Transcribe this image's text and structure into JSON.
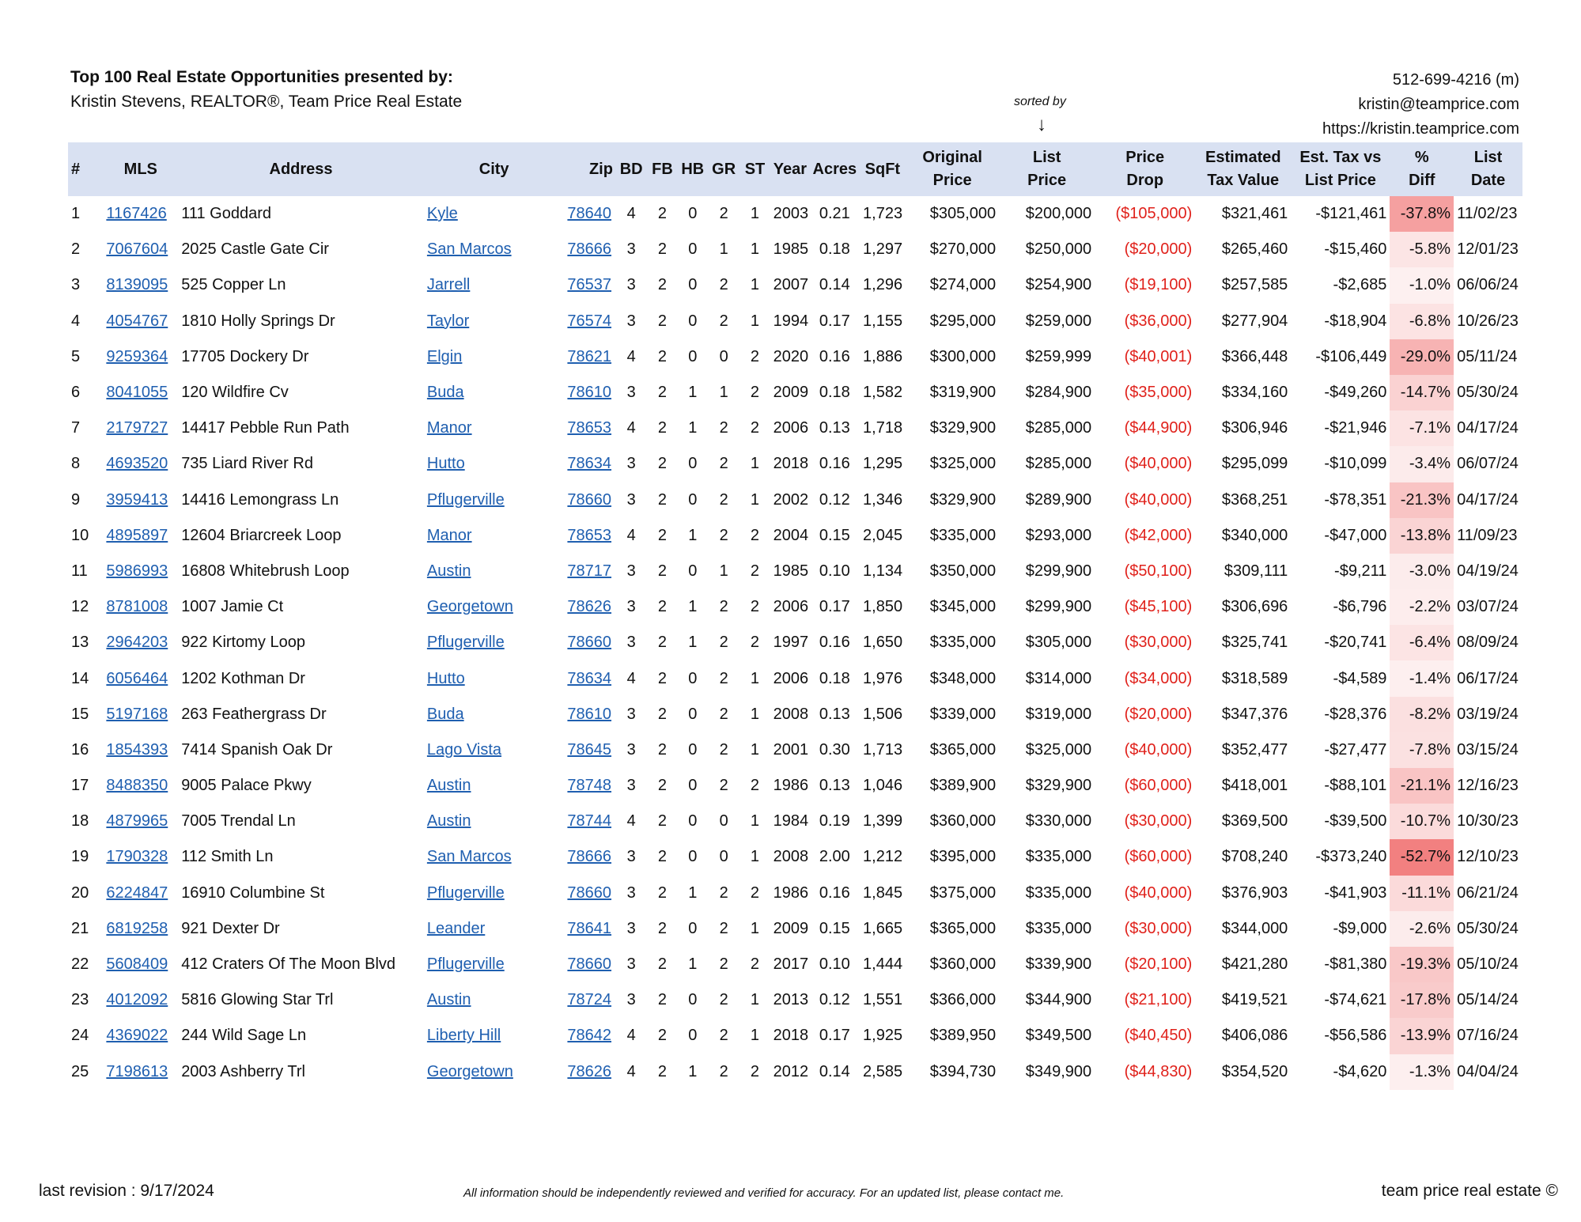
{
  "header": {
    "title": "Top 100 Real Estate Opportunities presented by:",
    "subtitle": "Kristin Stevens, REALTOR®, Team Price Real Estate",
    "sorted_by": "sorted by",
    "sort_arrow": "↓"
  },
  "contact": {
    "phone": "512-699-4216 (m)",
    "email": "kristin@teamprice.com",
    "website": "https://kristin.teamprice.com"
  },
  "columns": {
    "num": "#",
    "mls": "MLS",
    "address": "Address",
    "city": "City",
    "zip": "Zip",
    "bd": "BD",
    "fb": "FB",
    "hb": "HB",
    "gr": "GR",
    "st": "ST",
    "year": "Year",
    "acres": "Acres",
    "sqft": "SqFt",
    "orig_price_1": "Original",
    "orig_price_2": "Price",
    "list_price_1": "List",
    "list_price_2": "Price",
    "price_drop_1": "Price",
    "price_drop_2": "Drop",
    "tax_value_1": "Estimated",
    "tax_value_2": "Tax Value",
    "tax_vs_list_1": "Est. Tax vs",
    "tax_vs_list_2": "List Price",
    "pct_diff_1": "%",
    "pct_diff_2": "Diff",
    "list_date_1": "List",
    "list_date_2": "Date"
  },
  "pct_color_high": "#f28080",
  "pct_color_low": "#fdf2f2",
  "drop_color": "#e0211b",
  "link_color": "#1f5fb0",
  "header_bg": "#d9e1f2",
  "rows": [
    {
      "num": "1",
      "mls": "1167426",
      "address": "111 Goddard",
      "city": "Kyle",
      "zip": "78640",
      "bd": "4",
      "fb": "2",
      "hb": "0",
      "gr": "2",
      "st": "1",
      "year": "2003",
      "acres": "0.21",
      "sqft": "1,723",
      "orig": "$305,000",
      "list": "$200,000",
      "drop": "($105,000)",
      "tax": "$321,461",
      "diff": "-$121,461",
      "pct": "-37.8%",
      "pct_value": -37.8,
      "date": "11/02/23"
    },
    {
      "num": "2",
      "mls": "7067604",
      "address": "2025 Castle Gate Cir",
      "city": "San Marcos",
      "zip": "78666",
      "bd": "3",
      "fb": "2",
      "hb": "0",
      "gr": "1",
      "st": "1",
      "year": "1985",
      "acres": "0.18",
      "sqft": "1,297",
      "orig": "$270,000",
      "list": "$250,000",
      "drop": "($20,000)",
      "tax": "$265,460",
      "diff": "-$15,460",
      "pct": "-5.8%",
      "pct_value": -5.8,
      "date": "12/01/23"
    },
    {
      "num": "3",
      "mls": "8139095",
      "address": "525 Copper Ln",
      "city": "Jarrell",
      "zip": "76537",
      "bd": "3",
      "fb": "2",
      "hb": "0",
      "gr": "2",
      "st": "1",
      "year": "2007",
      "acres": "0.14",
      "sqft": "1,296",
      "orig": "$274,000",
      "list": "$254,900",
      "drop": "($19,100)",
      "tax": "$257,585",
      "diff": "-$2,685",
      "pct": "-1.0%",
      "pct_value": -1.0,
      "date": "06/06/24"
    },
    {
      "num": "4",
      "mls": "4054767",
      "address": "1810 Holly Springs Dr",
      "city": "Taylor",
      "zip": "76574",
      "bd": "3",
      "fb": "2",
      "hb": "0",
      "gr": "2",
      "st": "1",
      "year": "1994",
      "acres": "0.17",
      "sqft": "1,155",
      "orig": "$295,000",
      "list": "$259,000",
      "drop": "($36,000)",
      "tax": "$277,904",
      "diff": "-$18,904",
      "pct": "-6.8%",
      "pct_value": -6.8,
      "date": "10/26/23"
    },
    {
      "num": "5",
      "mls": "9259364",
      "address": "17705 Dockery Dr",
      "city": "Elgin",
      "zip": "78621",
      "bd": "4",
      "fb": "2",
      "hb": "0",
      "gr": "0",
      "st": "2",
      "year": "2020",
      "acres": "0.16",
      "sqft": "1,886",
      "orig": "$300,000",
      "list": "$259,999",
      "drop": "($40,001)",
      "tax": "$366,448",
      "diff": "-$106,449",
      "pct": "-29.0%",
      "pct_value": -29.0,
      "date": "05/11/24"
    },
    {
      "num": "6",
      "mls": "8041055",
      "address": "120 Wildfire Cv",
      "city": "Buda",
      "zip": "78610",
      "bd": "3",
      "fb": "2",
      "hb": "1",
      "gr": "1",
      "st": "2",
      "year": "2009",
      "acres": "0.18",
      "sqft": "1,582",
      "orig": "$319,900",
      "list": "$284,900",
      "drop": "($35,000)",
      "tax": "$334,160",
      "diff": "-$49,260",
      "pct": "-14.7%",
      "pct_value": -14.7,
      "date": "05/30/24"
    },
    {
      "num": "7",
      "mls": "2179727",
      "address": "14417 Pebble Run Path",
      "city": "Manor",
      "zip": "78653",
      "bd": "4",
      "fb": "2",
      "hb": "1",
      "gr": "2",
      "st": "2",
      "year": "2006",
      "acres": "0.13",
      "sqft": "1,718",
      "orig": "$329,900",
      "list": "$285,000",
      "drop": "($44,900)",
      "tax": "$306,946",
      "diff": "-$21,946",
      "pct": "-7.1%",
      "pct_value": -7.1,
      "date": "04/17/24"
    },
    {
      "num": "8",
      "mls": "4693520",
      "address": "735 Liard River Rd",
      "city": "Hutto",
      "zip": "78634",
      "bd": "3",
      "fb": "2",
      "hb": "0",
      "gr": "2",
      "st": "1",
      "year": "2018",
      "acres": "0.16",
      "sqft": "1,295",
      "orig": "$325,000",
      "list": "$285,000",
      "drop": "($40,000)",
      "tax": "$295,099",
      "diff": "-$10,099",
      "pct": "-3.4%",
      "pct_value": -3.4,
      "date": "06/07/24"
    },
    {
      "num": "9",
      "mls": "3959413",
      "address": "14416 Lemongrass Ln",
      "city": "Pflugerville",
      "zip": "78660",
      "bd": "3",
      "fb": "2",
      "hb": "0",
      "gr": "2",
      "st": "1",
      "year": "2002",
      "acres": "0.12",
      "sqft": "1,346",
      "orig": "$329,900",
      "list": "$289,900",
      "drop": "($40,000)",
      "tax": "$368,251",
      "diff": "-$78,351",
      "pct": "-21.3%",
      "pct_value": -21.3,
      "date": "04/17/24"
    },
    {
      "num": "10",
      "mls": "4895897",
      "address": "12604 Briarcreek Loop",
      "city": "Manor",
      "zip": "78653",
      "bd": "4",
      "fb": "2",
      "hb": "1",
      "gr": "2",
      "st": "2",
      "year": "2004",
      "acres": "0.15",
      "sqft": "2,045",
      "orig": "$335,000",
      "list": "$293,000",
      "drop": "($42,000)",
      "tax": "$340,000",
      "diff": "-$47,000",
      "pct": "-13.8%",
      "pct_value": -13.8,
      "date": "11/09/23"
    },
    {
      "num": "11",
      "mls": "5986993",
      "address": "16808 Whitebrush Loop",
      "city": "Austin",
      "zip": "78717",
      "bd": "3",
      "fb": "2",
      "hb": "0",
      "gr": "1",
      "st": "2",
      "year": "1985",
      "acres": "0.10",
      "sqft": "1,134",
      "orig": "$350,000",
      "list": "$299,900",
      "drop": "($50,100)",
      "tax": "$309,111",
      "diff": "-$9,211",
      "pct": "-3.0%",
      "pct_value": -3.0,
      "date": "04/19/24"
    },
    {
      "num": "12",
      "mls": "8781008",
      "address": "1007 Jamie Ct",
      "city": "Georgetown",
      "zip": "78626",
      "bd": "3",
      "fb": "2",
      "hb": "1",
      "gr": "2",
      "st": "2",
      "year": "2006",
      "acres": "0.17",
      "sqft": "1,850",
      "orig": "$345,000",
      "list": "$299,900",
      "drop": "($45,100)",
      "tax": "$306,696",
      "diff": "-$6,796",
      "pct": "-2.2%",
      "pct_value": -2.2,
      "date": "03/07/24"
    },
    {
      "num": "13",
      "mls": "2964203",
      "address": "922 Kirtomy Loop",
      "city": "Pflugerville",
      "zip": "78660",
      "bd": "3",
      "fb": "2",
      "hb": "1",
      "gr": "2",
      "st": "2",
      "year": "1997",
      "acres": "0.16",
      "sqft": "1,650",
      "orig": "$335,000",
      "list": "$305,000",
      "drop": "($30,000)",
      "tax": "$325,741",
      "diff": "-$20,741",
      "pct": "-6.4%",
      "pct_value": -6.4,
      "date": "08/09/24"
    },
    {
      "num": "14",
      "mls": "6056464",
      "address": "1202 Kothman Dr",
      "city": "Hutto",
      "zip": "78634",
      "bd": "4",
      "fb": "2",
      "hb": "0",
      "gr": "2",
      "st": "1",
      "year": "2006",
      "acres": "0.18",
      "sqft": "1,976",
      "orig": "$348,000",
      "list": "$314,000",
      "drop": "($34,000)",
      "tax": "$318,589",
      "diff": "-$4,589",
      "pct": "-1.4%",
      "pct_value": -1.4,
      "date": "06/17/24"
    },
    {
      "num": "15",
      "mls": "5197168",
      "address": "263 Feathergrass Dr",
      "city": "Buda",
      "zip": "78610",
      "bd": "3",
      "fb": "2",
      "hb": "0",
      "gr": "2",
      "st": "1",
      "year": "2008",
      "acres": "0.13",
      "sqft": "1,506",
      "orig": "$339,000",
      "list": "$319,000",
      "drop": "($20,000)",
      "tax": "$347,376",
      "diff": "-$28,376",
      "pct": "-8.2%",
      "pct_value": -8.2,
      "date": "03/19/24"
    },
    {
      "num": "16",
      "mls": "1854393",
      "address": "7414 Spanish Oak Dr",
      "city": "Lago Vista",
      "zip": "78645",
      "bd": "3",
      "fb": "2",
      "hb": "0",
      "gr": "2",
      "st": "1",
      "year": "2001",
      "acres": "0.30",
      "sqft": "1,713",
      "orig": "$365,000",
      "list": "$325,000",
      "drop": "($40,000)",
      "tax": "$352,477",
      "diff": "-$27,477",
      "pct": "-7.8%",
      "pct_value": -7.8,
      "date": "03/15/24"
    },
    {
      "num": "17",
      "mls": "8488350",
      "address": "9005 Palace Pkwy",
      "city": "Austin",
      "zip": "78748",
      "bd": "3",
      "fb": "2",
      "hb": "0",
      "gr": "2",
      "st": "2",
      "year": "1986",
      "acres": "0.13",
      "sqft": "1,046",
      "orig": "$389,900",
      "list": "$329,900",
      "drop": "($60,000)",
      "tax": "$418,001",
      "diff": "-$88,101",
      "pct": "-21.1%",
      "pct_value": -21.1,
      "date": "12/16/23"
    },
    {
      "num": "18",
      "mls": "4879965",
      "address": "7005 Trendal Ln",
      "city": "Austin",
      "zip": "78744",
      "bd": "4",
      "fb": "2",
      "hb": "0",
      "gr": "0",
      "st": "1",
      "year": "1984",
      "acres": "0.19",
      "sqft": "1,399",
      "orig": "$360,000",
      "list": "$330,000",
      "drop": "($30,000)",
      "tax": "$369,500",
      "diff": "-$39,500",
      "pct": "-10.7%",
      "pct_value": -10.7,
      "date": "10/30/23"
    },
    {
      "num": "19",
      "mls": "1790328",
      "address": "112 Smith Ln",
      "city": "San Marcos",
      "zip": "78666",
      "bd": "3",
      "fb": "2",
      "hb": "0",
      "gr": "0",
      "st": "1",
      "year": "2008",
      "acres": "2.00",
      "sqft": "1,212",
      "orig": "$395,000",
      "list": "$335,000",
      "drop": "($60,000)",
      "tax": "$708,240",
      "diff": "-$373,240",
      "pct": "-52.7%",
      "pct_value": -52.7,
      "date": "12/10/23"
    },
    {
      "num": "20",
      "mls": "6224847",
      "address": "16910 Columbine St",
      "city": "Pflugerville",
      "zip": "78660",
      "bd": "3",
      "fb": "2",
      "hb": "1",
      "gr": "2",
      "st": "2",
      "year": "1986",
      "acres": "0.16",
      "sqft": "1,845",
      "orig": "$375,000",
      "list": "$335,000",
      "drop": "($40,000)",
      "tax": "$376,903",
      "diff": "-$41,903",
      "pct": "-11.1%",
      "pct_value": -11.1,
      "date": "06/21/24"
    },
    {
      "num": "21",
      "mls": "6819258",
      "address": "921 Dexter Dr",
      "city": "Leander",
      "zip": "78641",
      "bd": "3",
      "fb": "2",
      "hb": "0",
      "gr": "2",
      "st": "1",
      "year": "2009",
      "acres": "0.15",
      "sqft": "1,665",
      "orig": "$365,000",
      "list": "$335,000",
      "drop": "($30,000)",
      "tax": "$344,000",
      "diff": "-$9,000",
      "pct": "-2.6%",
      "pct_value": -2.6,
      "date": "05/30/24"
    },
    {
      "num": "22",
      "mls": "5608409",
      "address": "412 Craters Of The Moon Blvd",
      "city": "Pflugerville",
      "zip": "78660",
      "bd": "3",
      "fb": "2",
      "hb": "1",
      "gr": "2",
      "st": "2",
      "year": "2017",
      "acres": "0.10",
      "sqft": "1,444",
      "orig": "$360,000",
      "list": "$339,900",
      "drop": "($20,100)",
      "tax": "$421,280",
      "diff": "-$81,380",
      "pct": "-19.3%",
      "pct_value": -19.3,
      "date": "05/10/24"
    },
    {
      "num": "23",
      "mls": "4012092",
      "address": "5816 Glowing Star Trl",
      "city": "Austin",
      "zip": "78724",
      "bd": "3",
      "fb": "2",
      "hb": "0",
      "gr": "2",
      "st": "1",
      "year": "2013",
      "acres": "0.12",
      "sqft": "1,551",
      "orig": "$366,000",
      "list": "$344,900",
      "drop": "($21,100)",
      "tax": "$419,521",
      "diff": "-$74,621",
      "pct": "-17.8%",
      "pct_value": -17.8,
      "date": "05/14/24"
    },
    {
      "num": "24",
      "mls": "4369022",
      "address": "244 Wild Sage Ln",
      "city": "Liberty Hill",
      "zip": "78642",
      "bd": "4",
      "fb": "2",
      "hb": "0",
      "gr": "2",
      "st": "1",
      "year": "2018",
      "acres": "0.17",
      "sqft": "1,925",
      "orig": "$389,950",
      "list": "$349,500",
      "drop": "($40,450)",
      "tax": "$406,086",
      "diff": "-$56,586",
      "pct": "-13.9%",
      "pct_value": -13.9,
      "date": "07/16/24"
    },
    {
      "num": "25",
      "mls": "7198613",
      "address": "2003 Ashberry Trl",
      "city": "Georgetown",
      "zip": "78626",
      "bd": "4",
      "fb": "2",
      "hb": "1",
      "gr": "2",
      "st": "2",
      "year": "2012",
      "acres": "0.14",
      "sqft": "2,585",
      "orig": "$394,730",
      "list": "$349,900",
      "drop": "($44,830)",
      "tax": "$354,520",
      "diff": "-$4,620",
      "pct": "-1.3%",
      "pct_value": -1.3,
      "date": "04/04/24"
    }
  ],
  "footer": {
    "revision": "last revision : 9/17/2024",
    "disclaimer": "All information should be independently reviewed and verified for accuracy. For an updated list, please contact me.",
    "brand": "team price real estate ©"
  }
}
